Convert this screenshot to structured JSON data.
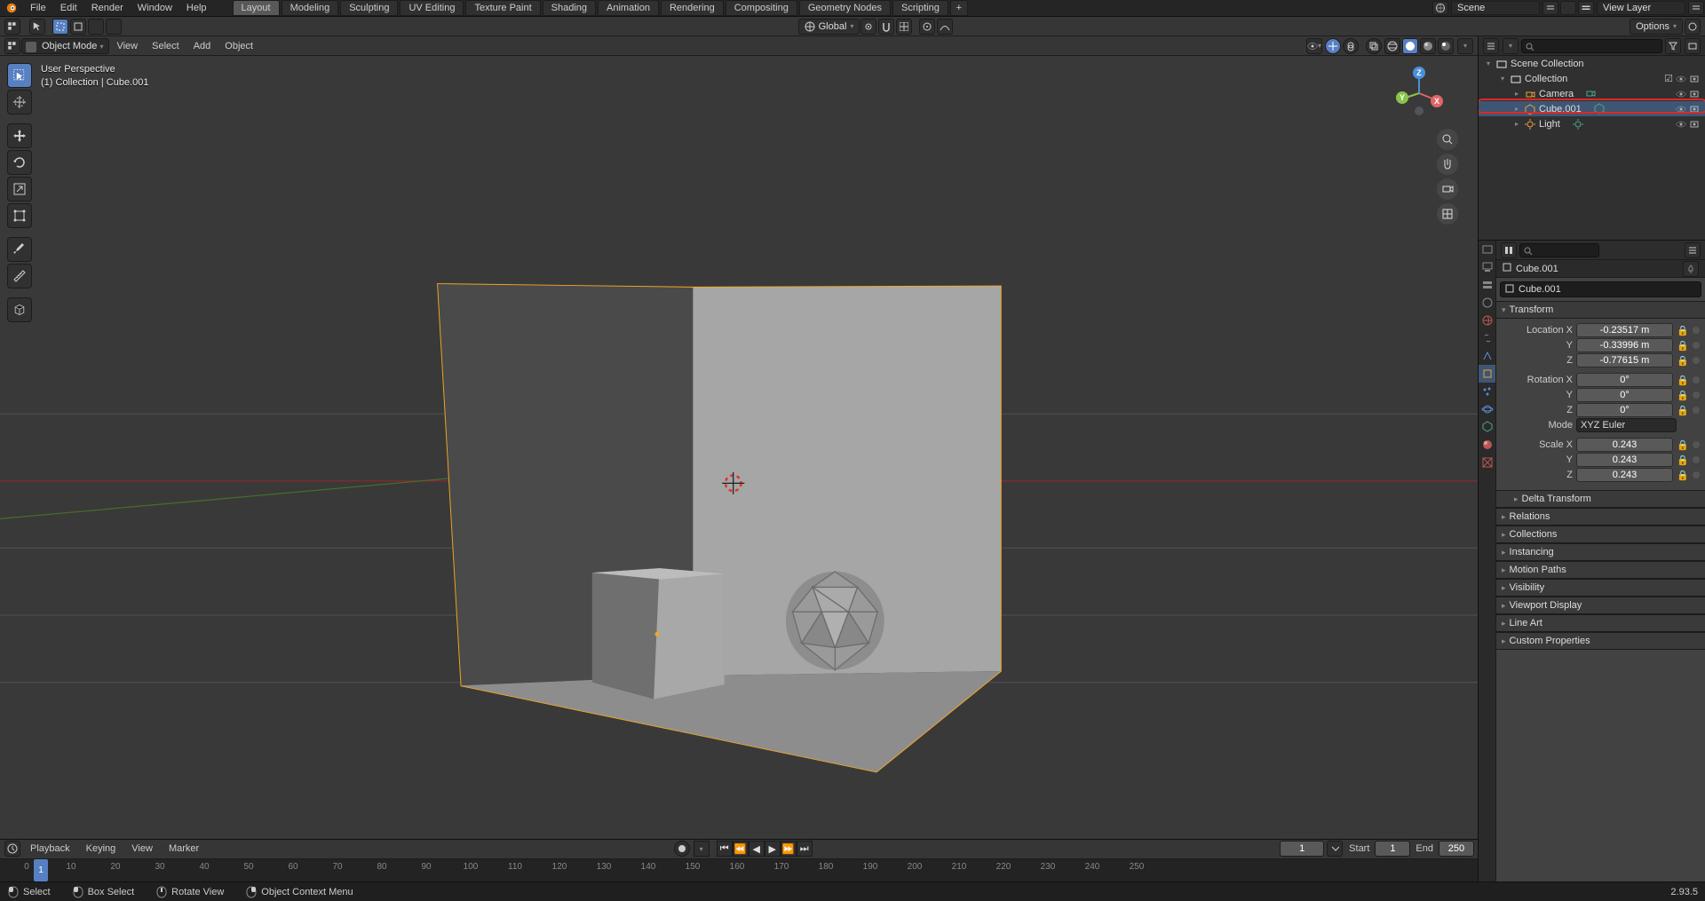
{
  "top_menu": [
    "File",
    "Edit",
    "Render",
    "Window",
    "Help"
  ],
  "workspace_tabs": [
    "Layout",
    "Modeling",
    "Sculpting",
    "UV Editing",
    "Texture Paint",
    "Shading",
    "Animation",
    "Rendering",
    "Compositing",
    "Geometry Nodes",
    "Scripting"
  ],
  "active_tab": "Layout",
  "scene_label": "Scene",
  "viewlayer_label": "View Layer",
  "orientation": "Global",
  "mode_label": "Object Mode",
  "view_menus": [
    "View",
    "Select",
    "Add",
    "Object"
  ],
  "options_label": "Options",
  "viewport_info": {
    "line1": "User Perspective",
    "line2": "(1) Collection | Cube.001"
  },
  "timeline": {
    "menus": [
      "Playback",
      "Keying",
      "View",
      "Marker"
    ],
    "current": "1",
    "start_label": "Start",
    "start": "1",
    "end_label": "End",
    "end": "250",
    "ticks": [
      "0",
      "10",
      "20",
      "30",
      "40",
      "50",
      "60",
      "70",
      "80",
      "90",
      "100",
      "110",
      "120",
      "130",
      "140",
      "150",
      "160",
      "170",
      "180",
      "190",
      "200",
      "210",
      "220",
      "230",
      "240",
      "250"
    ]
  },
  "status": {
    "select": "Select",
    "box": "Box Select",
    "rotate": "Rotate View",
    "ctx": "Object Context Menu",
    "version": "2.93.5"
  },
  "outliner": {
    "root": "Scene Collection",
    "coll": "Collection",
    "items": [
      {
        "name": "Camera"
      },
      {
        "name": "Cube.001"
      },
      {
        "name": "Light"
      }
    ]
  },
  "properties": {
    "crumb": "Cube.001",
    "name": "Cube.001",
    "panel_transform": "Transform",
    "loc_label": "Location X",
    "loc_x": "-0.23517 m",
    "loc_y": "-0.33996 m",
    "loc_z": "-0.77615 m",
    "rot_label": "Rotation X",
    "rot_x": "0°",
    "rot_y": "0°",
    "rot_z": "0°",
    "mode_label": "Mode",
    "mode_value": "XYZ Euler",
    "scale_label": "Scale X",
    "scale_x": "0.243",
    "scale_y": "0.243",
    "scale_z": "0.243",
    "axis_y": "Y",
    "axis_z": "Z",
    "panels": [
      "Delta Transform",
      "Relations",
      "Collections",
      "Instancing",
      "Motion Paths",
      "Visibility",
      "Viewport Display",
      "Line Art",
      "Custom Properties"
    ]
  }
}
